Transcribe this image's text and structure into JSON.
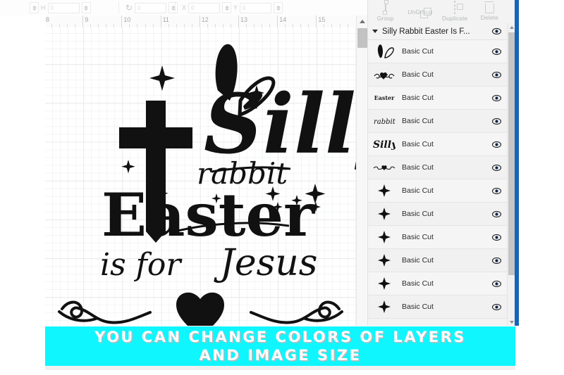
{
  "toolbar": {
    "height_label": "H",
    "height_value": "0",
    "rotation_icon": "rotate-icon",
    "rotation_value": "0",
    "x_label": "X",
    "x_value": "0",
    "y_label": "Y",
    "y_value": "0"
  },
  "ruler": {
    "unit_labels": [
      "8",
      "9",
      "10",
      "11",
      "12",
      "13",
      "14",
      "15"
    ]
  },
  "panel": {
    "tools": [
      {
        "label": "Group",
        "icon": "group-icon"
      },
      {
        "label": "UnGroup",
        "icon": "ungroup-icon"
      },
      {
        "label": "Duplicate",
        "icon": "duplicate-icon"
      },
      {
        "label": "Delete",
        "icon": "trash-icon"
      }
    ],
    "layer_group_title": "Silly Rabbit Easter Is F...",
    "layer_group_visibility_icon": "eye-icon",
    "rows": [
      {
        "name": "Basic Cut",
        "thumb": "bunny-ears",
        "visibility_icon": "eye-icon"
      },
      {
        "name": "Basic Cut",
        "thumb": "flourish",
        "visibility_icon": "eye-icon"
      },
      {
        "name": "Basic Cut",
        "thumb": "easter-word",
        "visibility_icon": "eye-icon"
      },
      {
        "name": "Basic Cut",
        "thumb": "rabbit-word",
        "visibility_icon": "eye-icon"
      },
      {
        "name": "Basic Cut",
        "thumb": "silly-word",
        "visibility_icon": "eye-icon"
      },
      {
        "name": "Basic Cut",
        "thumb": "swirl-heart",
        "visibility_icon": "eye-icon"
      },
      {
        "name": "Basic Cut",
        "thumb": "sparkle",
        "visibility_icon": "eye-icon"
      },
      {
        "name": "Basic Cut",
        "thumb": "sparkle",
        "visibility_icon": "eye-icon"
      },
      {
        "name": "Basic Cut",
        "thumb": "sparkle",
        "visibility_icon": "eye-icon"
      },
      {
        "name": "Basic Cut",
        "thumb": "sparkle",
        "visibility_icon": "eye-icon"
      },
      {
        "name": "Basic Cut",
        "thumb": "sparkle",
        "visibility_icon": "eye-icon"
      },
      {
        "name": "Basic Cut",
        "thumb": "sparkle",
        "visibility_icon": "eye-icon"
      }
    ]
  },
  "artwork": {
    "lines": [
      "Silly",
      "rabbit",
      "Easter",
      "is for Jesus"
    ],
    "elements": [
      "cross",
      "bunny-ears",
      "sparkles",
      "heart",
      "flourish"
    ]
  },
  "banner": {
    "line1": "YOU CAN CHANGE COLORS OF LAYERS",
    "line2": "AND IMAGE SIZE",
    "background_color": "#0ff6ff",
    "text_color": "#ffffff"
  },
  "accent": {
    "blue_strip": "#1565b8"
  }
}
